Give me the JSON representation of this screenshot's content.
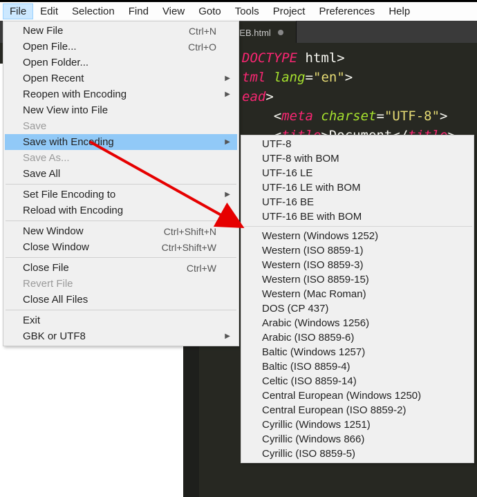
{
  "menubar": {
    "items": [
      {
        "label": "File",
        "active": true
      },
      {
        "label": "Edit"
      },
      {
        "label": "Selection"
      },
      {
        "label": "Find"
      },
      {
        "label": "View"
      },
      {
        "label": "Goto"
      },
      {
        "label": "Tools"
      },
      {
        "label": "Project"
      },
      {
        "label": "Preferences"
      },
      {
        "label": "Help"
      }
    ]
  },
  "tab": {
    "label": "了解WEB.html"
  },
  "code_tokens": [
    [
      {
        "t": "DOCTYPE",
        "c": "kw"
      },
      {
        "t": " html",
        "c": "punc"
      },
      {
        "t": ">",
        "c": "punc"
      }
    ],
    [
      {
        "t": "tml",
        "c": "kw"
      },
      {
        "t": " ",
        "c": "punc"
      },
      {
        "t": "lang",
        "c": "attr"
      },
      {
        "t": "=",
        "c": "punc"
      },
      {
        "t": "\"en\"",
        "c": "str"
      },
      {
        "t": ">",
        "c": "punc"
      }
    ],
    [
      {
        "t": "ead",
        "c": "kw"
      },
      {
        "t": ">",
        "c": "punc"
      }
    ],
    [
      {
        "t": "    <",
        "c": "punc"
      },
      {
        "t": "meta",
        "c": "kw"
      },
      {
        "t": " ",
        "c": "punc"
      },
      {
        "t": "charset",
        "c": "attr"
      },
      {
        "t": "=",
        "c": "punc"
      },
      {
        "t": "\"UTF-8\"",
        "c": "str"
      },
      {
        "t": ">",
        "c": "punc"
      }
    ],
    [
      {
        "t": "    <",
        "c": "punc"
      },
      {
        "t": "title",
        "c": "kw"
      },
      {
        "t": ">",
        "c": "punc"
      },
      {
        "t": "Document",
        "c": "punc"
      },
      {
        "t": "</",
        "c": "punc"
      },
      {
        "t": "title",
        "c": "kw"
      },
      {
        "t": ">",
        "c": "punc"
      }
    ]
  ],
  "file_menu": [
    {
      "label": "New File",
      "shortcut": "Ctrl+N"
    },
    {
      "label": "Open File...",
      "shortcut": "Ctrl+O"
    },
    {
      "label": "Open Folder..."
    },
    {
      "label": "Open Recent",
      "submenu": true
    },
    {
      "label": "Reopen with Encoding",
      "submenu": true
    },
    {
      "label": "New View into File"
    },
    {
      "label": "Save",
      "disabled": true
    },
    {
      "label": "Save with Encoding",
      "submenu": true,
      "highlight": true
    },
    {
      "label": "Save As...",
      "disabled": true
    },
    {
      "label": "Save All"
    },
    {
      "sep": true
    },
    {
      "label": "Set File Encoding to",
      "submenu": true
    },
    {
      "label": "Reload with Encoding",
      "submenu": true
    },
    {
      "sep": true
    },
    {
      "label": "New Window",
      "shortcut": "Ctrl+Shift+N"
    },
    {
      "label": "Close Window",
      "shortcut": "Ctrl+Shift+W"
    },
    {
      "sep": true
    },
    {
      "label": "Close File",
      "shortcut": "Ctrl+W"
    },
    {
      "label": "Revert File",
      "disabled": true
    },
    {
      "label": "Close All Files"
    },
    {
      "sep": true
    },
    {
      "label": "Exit"
    },
    {
      "label": "GBK or UTF8",
      "submenu": true
    }
  ],
  "encoding_menu": [
    {
      "label": "UTF-8"
    },
    {
      "label": "UTF-8 with BOM"
    },
    {
      "label": "UTF-16 LE"
    },
    {
      "label": "UTF-16 LE with BOM"
    },
    {
      "label": "UTF-16 BE"
    },
    {
      "label": "UTF-16 BE with BOM"
    },
    {
      "sep": true
    },
    {
      "label": "Western (Windows 1252)"
    },
    {
      "label": "Western (ISO 8859-1)"
    },
    {
      "label": "Western (ISO 8859-3)"
    },
    {
      "label": "Western (ISO 8859-15)"
    },
    {
      "label": "Western (Mac Roman)"
    },
    {
      "label": "DOS (CP 437)"
    },
    {
      "label": "Arabic (Windows 1256)"
    },
    {
      "label": "Arabic (ISO 8859-6)"
    },
    {
      "label": "Baltic (Windows 1257)"
    },
    {
      "label": "Baltic (ISO 8859-4)"
    },
    {
      "label": "Celtic (ISO 8859-14)"
    },
    {
      "label": "Central European (Windows 1250)"
    },
    {
      "label": "Central European (ISO 8859-2)"
    },
    {
      "label": "Cyrillic (Windows 1251)"
    },
    {
      "label": "Cyrillic (Windows 866)"
    },
    {
      "label": "Cyrillic (ISO 8859-5)"
    }
  ]
}
